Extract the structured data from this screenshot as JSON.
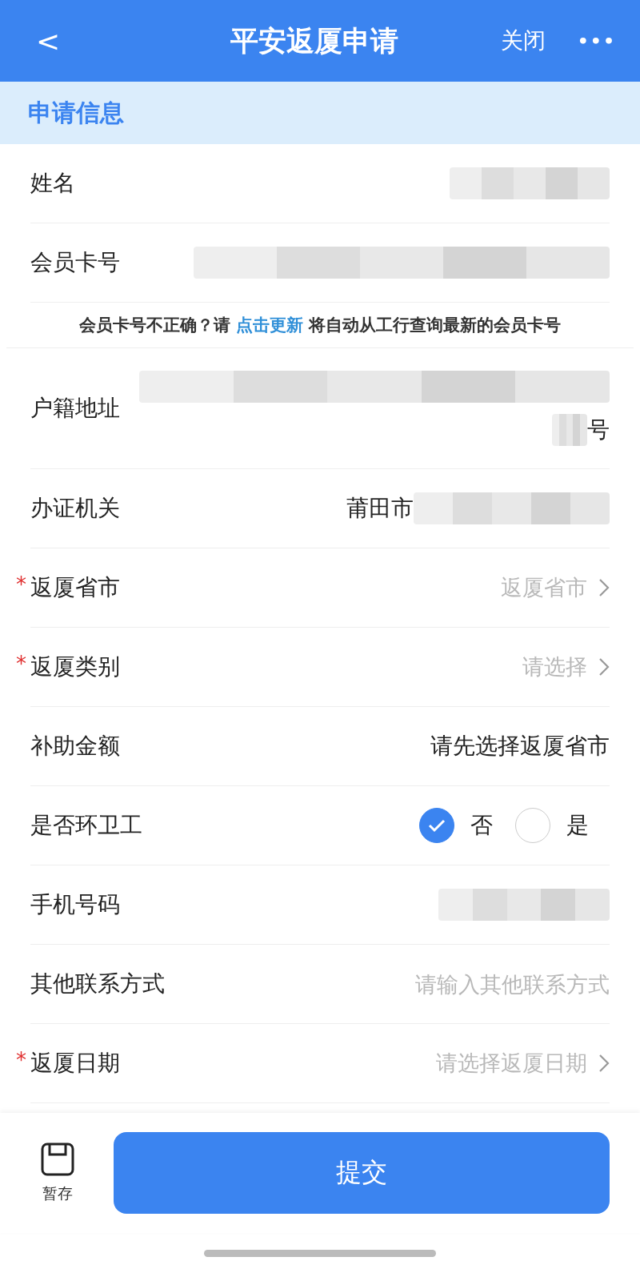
{
  "header": {
    "back": "<",
    "title": "平安返厦申请",
    "close": "关闭",
    "more": "•••"
  },
  "section": {
    "title": "申请信息"
  },
  "rows": [
    {
      "kind": "redacted",
      "label": "姓名"
    },
    {
      "kind": "redacted",
      "label": "会员卡号"
    },
    {
      "kind": "notice",
      "parts": [
        "会员卡号不正确？请 ",
        "点击更新",
        " 将自动从工行查询最新的会员卡号"
      ]
    },
    {
      "kind": "address",
      "label": "户籍地址",
      "tail": "号"
    },
    {
      "kind": "partial",
      "label": "办证机关",
      "value": "莆田市"
    },
    {
      "kind": "select",
      "label": "返厦省市",
      "required_mark": "*",
      "placeholder": "返厦省市"
    },
    {
      "kind": "select",
      "label": "返厦类别",
      "required_mark": "*",
      "placeholder": "请选择"
    },
    {
      "kind": "text",
      "label": "补助金额",
      "value": "请先选择返厦省市"
    },
    {
      "kind": "radio",
      "label": "是否环卫工",
      "options": [
        {
          "label": "否",
          "selected": true
        },
        {
          "label": "是",
          "selected": false
        }
      ]
    },
    {
      "kind": "redacted",
      "label": "手机号码"
    },
    {
      "kind": "input",
      "label": "其他联系方式",
      "placeholder": "请输入其他联系方式"
    },
    {
      "kind": "select",
      "label": "返厦日期",
      "required_mark": "*",
      "placeholder": "请选择返厦日期"
    }
  ],
  "footer": {
    "save": "暂存",
    "submit": "提交"
  }
}
